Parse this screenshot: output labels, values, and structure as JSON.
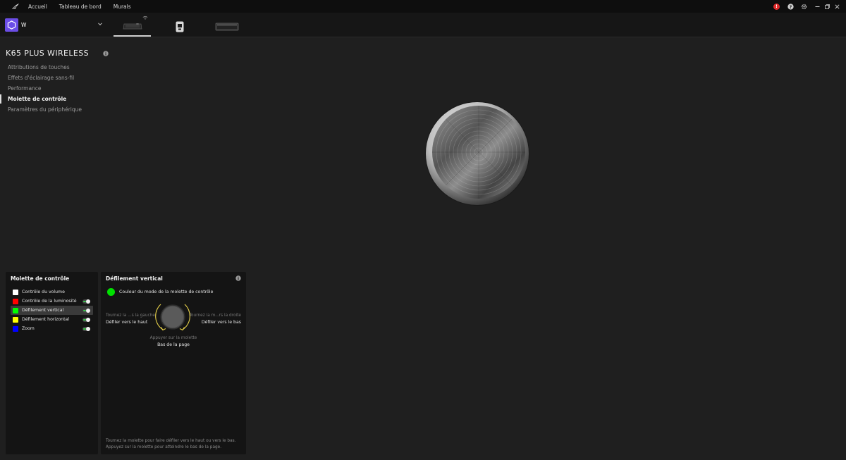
{
  "nav": {
    "links": [
      "Accueil",
      "Tableau de bord",
      "Murals"
    ],
    "alert_count": "!"
  },
  "profile": {
    "name": "W"
  },
  "device": {
    "title": "K65 PLUS WIRELESS",
    "menu": [
      "Attributions de touches",
      "Effets d'éclairage sans-fil",
      "Performance",
      "Molette de contrôle",
      "Paramètres du périphérique"
    ],
    "active_menu_index": 3
  },
  "modes_panel": {
    "title": "Molette de contrôle",
    "modes": [
      {
        "label": "Contrôle du volume",
        "color": "#ffffff",
        "toggle": false
      },
      {
        "label": "Contrôle de la luminosité",
        "color": "#ff0000",
        "toggle": true
      },
      {
        "label": "Défilement vertical",
        "color": "#00ff00",
        "toggle": true,
        "selected": true
      },
      {
        "label": "Défilement horizontal",
        "color": "#ffff00",
        "toggle": true
      },
      {
        "label": "Zoom",
        "color": "#0000ff",
        "toggle": true
      }
    ]
  },
  "detail_panel": {
    "title": "Défilement vertical",
    "color_label": "Couleur du mode de la molette de contrôle",
    "mode_color": "#00e000",
    "left_hint": "Tournez la ...s la gauche",
    "left_action": "Défiler vers le haut",
    "right_hint": "Tournez la m...rs la droite",
    "right_action": "Défiler vers le bas",
    "press_hint": "Appuyer sur la molette",
    "press_action": "Bas de la page",
    "footer_line1": "Tournez la molette pour faire défiler vers le haut ou vers le bas.",
    "footer_line2": "Appuyez sur la molette pour atteindre le bas de la page."
  },
  "colors": {
    "accent": "#6b4de6",
    "alert": "#e02b2b",
    "arrow": "#e8d24a"
  }
}
